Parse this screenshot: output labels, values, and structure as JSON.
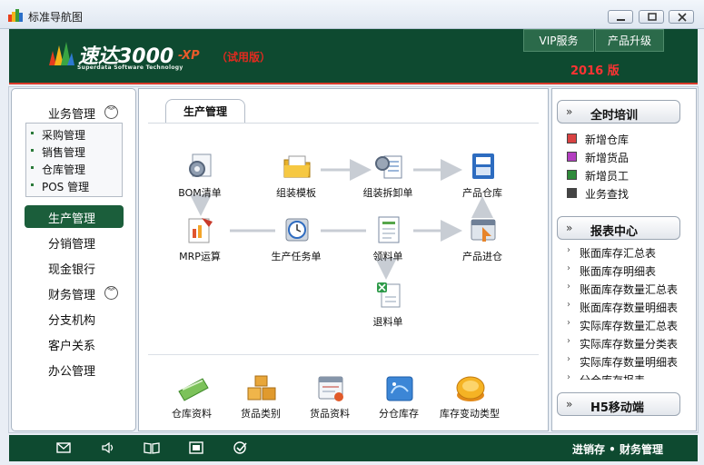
{
  "window": {
    "title": "标准导航图"
  },
  "header": {
    "logo_name": "速达3000",
    "logo_sub": "Superdata Software Technology",
    "logo_xp": "-XP",
    "logo_trial": "（试用版）",
    "vip_label": "VIP服务",
    "upgrade_label": "产品升级",
    "year_label": "2016 版"
  },
  "sidebar": {
    "business": "业务管理",
    "sub_items": [
      "采购管理",
      "销售管理",
      "仓库管理",
      "POS 管理"
    ],
    "items": [
      "生产管理",
      "分销管理",
      "现金银行"
    ],
    "finance": "财务管理",
    "items2": [
      "分支机构",
      "客户关系",
      "办公管理"
    ]
  },
  "main": {
    "tab": "生产管理",
    "flow": [
      "BOM清单",
      "组装模板",
      "组装拆卸单",
      "产品仓库",
      "MRP运算",
      "生产任务单",
      "领料单",
      "产品进仓",
      "退料单"
    ],
    "bottom": [
      "仓库资料",
      "货品类别",
      "货品资料",
      "分仓库存",
      "库存变动类型"
    ]
  },
  "right": {
    "training_title": "全时培训",
    "training_items": [
      "新增仓库",
      "新增货品",
      "新增员工",
      "业务查找"
    ],
    "report_title": "报表中心",
    "report_items": [
      "账面库存汇总表",
      "账面库存明细表",
      "账面库存数量汇总表",
      "账面库存数量明细表",
      "实际库存数量汇总表",
      "实际库存数量分类表",
      "实际库存数量明细表",
      "分仓库存报表"
    ],
    "h5_title": "H5移动端"
  },
  "footer": {
    "text": "进销存 • 财务管理"
  },
  "colors": {
    "header_green": "#0e4a30",
    "active_green": "#1b5e3b",
    "accent_red": "#e52a1f"
  },
  "icons": {
    "footer": [
      "mail-icon",
      "speaker-icon",
      "book-icon",
      "window-icon",
      "check-icon"
    ]
  }
}
